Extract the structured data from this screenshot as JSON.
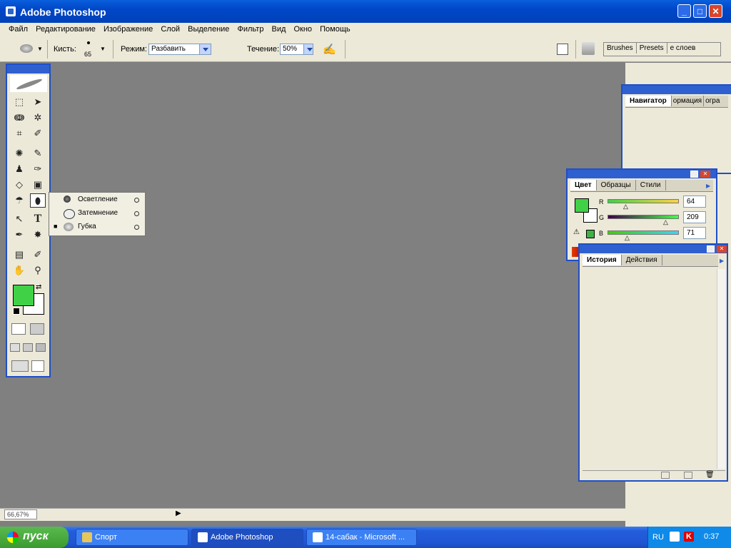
{
  "app": {
    "title": "Adobe Photoshop"
  },
  "window_controls": {
    "minimize": "_",
    "maximize": "□",
    "close": "✕"
  },
  "menu": [
    {
      "label": "Файл"
    },
    {
      "label": "Редактирование"
    },
    {
      "label": "Изображение"
    },
    {
      "label": "Слой"
    },
    {
      "label": "Выделение"
    },
    {
      "label": "Фильтр"
    },
    {
      "label": "Вид"
    },
    {
      "label": "Окно"
    },
    {
      "label": "Помощь"
    }
  ],
  "options": {
    "brush_label": "Кисть:",
    "brush_size": "65",
    "mode_label": "Режим:",
    "mode_value": "Разбавить",
    "flow_label": "Течение:",
    "flow_value": "50%",
    "well_tabs": [
      {
        "label": "Brushes"
      },
      {
        "label": "Presets"
      },
      {
        "label": "е слоев"
      }
    ]
  },
  "flyout": {
    "items": [
      {
        "label": "Осветление",
        "icon": "dodge-icon",
        "selected": false
      },
      {
        "label": "Затемнение",
        "icon": "burn-icon",
        "selected": false
      },
      {
        "label": "Губка",
        "icon": "sponge-icon",
        "selected": true
      }
    ],
    "selected_marker": "■"
  },
  "navigator_panel": {
    "tabs": [
      {
        "label": "Навигатор"
      },
      {
        "label": "ормация"
      },
      {
        "label": "огра"
      }
    ]
  },
  "color_panel": {
    "tabs": [
      {
        "label": "Цвет"
      },
      {
        "label": "Образцы"
      },
      {
        "label": "Стили"
      }
    ],
    "channels": [
      {
        "name": "R",
        "value": "64"
      },
      {
        "name": "G",
        "value": "209"
      },
      {
        "name": "B",
        "value": "71"
      }
    ],
    "foreground": "#40d147",
    "background": "#ffffff"
  },
  "history_panel": {
    "tabs": [
      {
        "label": "История"
      },
      {
        "label": "Действия"
      }
    ]
  },
  "status": {
    "zoom": "66,67%"
  },
  "taskbar": {
    "start_label": "пуск",
    "tasks": [
      {
        "label": "Спорт"
      },
      {
        "label": "Adobe Photoshop"
      },
      {
        "label": "14-сабак - Microsoft ..."
      }
    ],
    "tray": {
      "lang": "RU",
      "time": "0:37"
    }
  }
}
